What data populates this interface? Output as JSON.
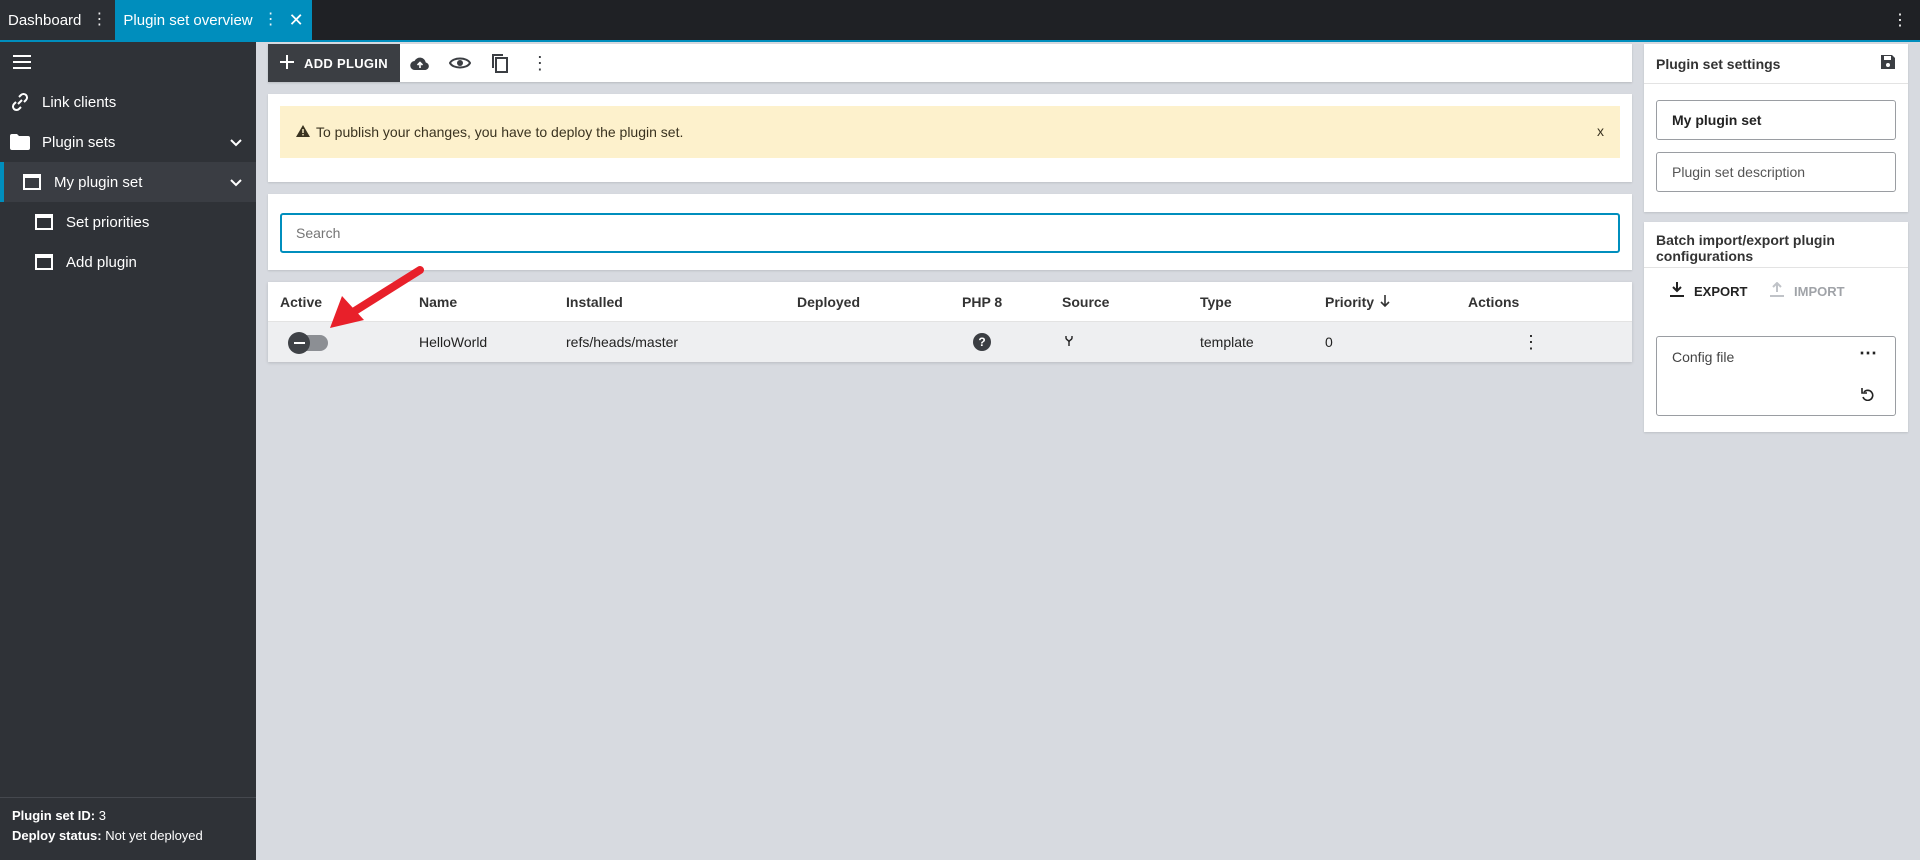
{
  "tabs": [
    {
      "label": "Dashboard"
    },
    {
      "label": "Plugin set overview"
    }
  ],
  "sidebar": {
    "items": [
      {
        "label": "Link clients"
      },
      {
        "label": "Plugin sets"
      },
      {
        "label": "My plugin set"
      },
      {
        "label": "Set priorities"
      },
      {
        "label": "Add plugin"
      }
    ],
    "footer": {
      "id_label": "Plugin set ID:",
      "id_value": "3",
      "status_label": "Deploy status:",
      "status_value": "Not yet deployed"
    }
  },
  "toolbar": {
    "add_plugin_label": "ADD PLUGIN"
  },
  "alert": {
    "message": "To publish your changes, you have to deploy the plugin set.",
    "close": "x"
  },
  "search": {
    "placeholder": "Search"
  },
  "table": {
    "headers": {
      "active": "Active",
      "name": "Name",
      "installed": "Installed",
      "deployed": "Deployed",
      "php8": "PHP 8",
      "source": "Source",
      "type": "Type",
      "priority": "Priority",
      "actions": "Actions"
    },
    "rows": [
      {
        "name": "HelloWorld",
        "installed": "refs/heads/master",
        "deployed": "",
        "php8": "?",
        "type": "template",
        "priority": "0"
      }
    ]
  },
  "settings": {
    "title": "Plugin set settings",
    "name_value": "My plugin set",
    "description_placeholder": "Plugin set description"
  },
  "batch": {
    "title": "Batch import/export plugin configurations",
    "export_label": "EXPORT",
    "import_label": "IMPORT",
    "config_label": "Config file"
  },
  "colors": {
    "accent": "#008ebd",
    "alert_bg": "#fdf1cc",
    "sidebar_bg": "#2f3237",
    "annotation": "#e8202a"
  }
}
